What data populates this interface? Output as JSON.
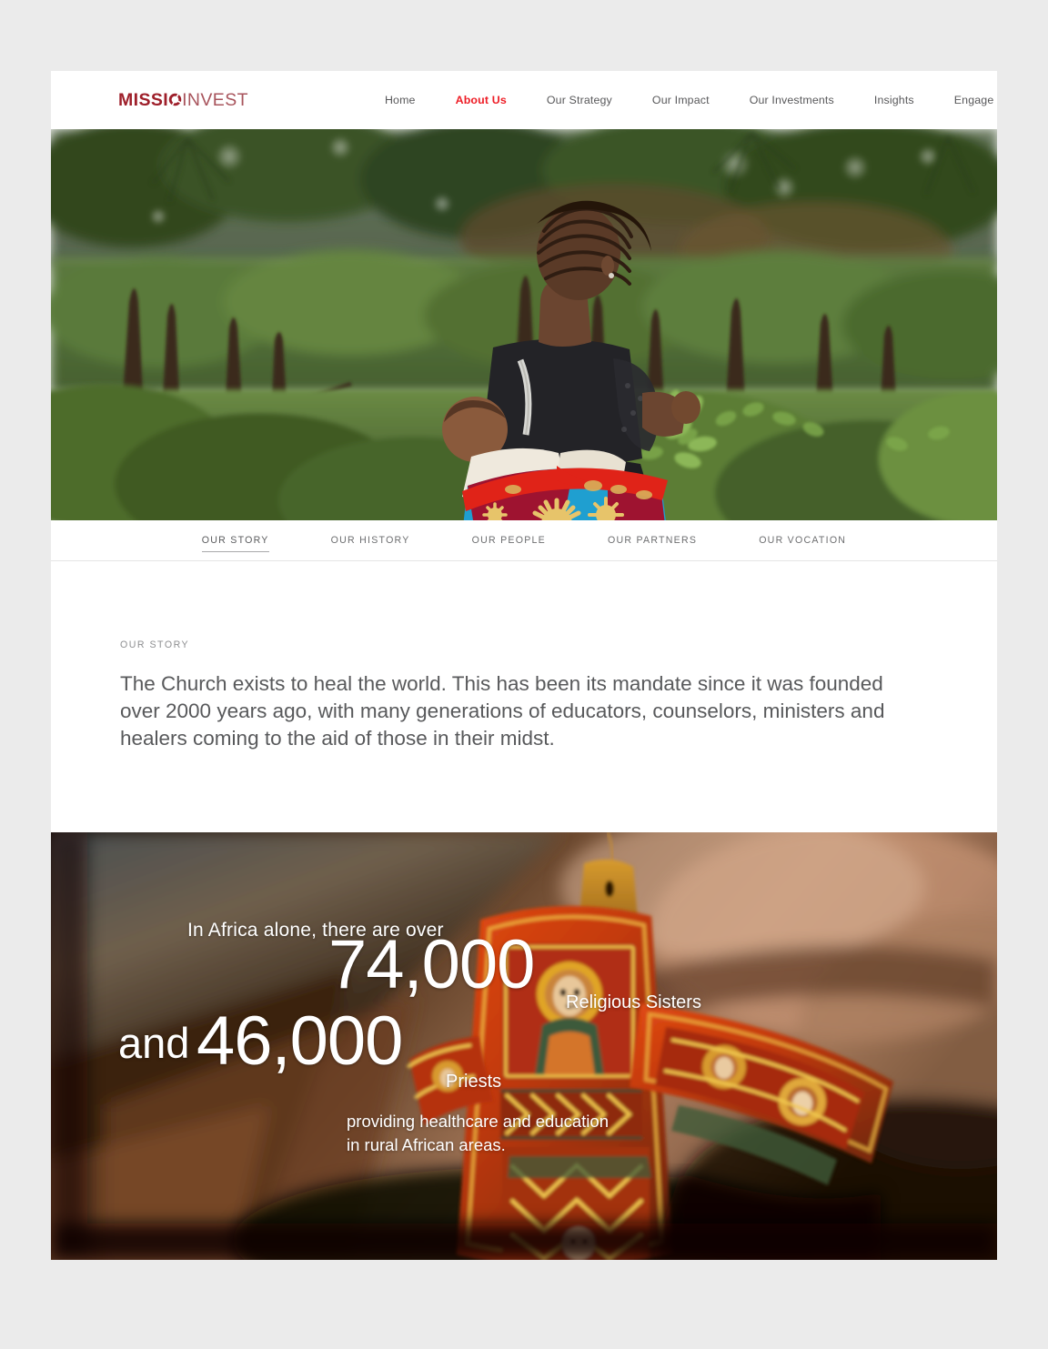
{
  "brand": {
    "logo_text_bold": "MISSI",
    "logo_icon": "missio-o-mark",
    "logo_text_light": "INVEST",
    "color_dark_red": "#9e1f2a",
    "color_light_red": "#a8545c",
    "color_active_red": "#ee1c25"
  },
  "mainnav": {
    "items": [
      {
        "label": "Home",
        "active": false
      },
      {
        "label": "About Us",
        "active": true
      },
      {
        "label": "Our Strategy",
        "active": false
      },
      {
        "label": "Our Impact",
        "active": false
      },
      {
        "label": "Our Investments",
        "active": false
      },
      {
        "label": "Insights",
        "active": false
      },
      {
        "label": "Engage | Contact",
        "active": false
      }
    ]
  },
  "hero": {
    "alt": "Woman carrying a baby in a colorful wrap, facing a lush green African forest clearing"
  },
  "subnav": {
    "items": [
      {
        "label": "OUR STORY",
        "active": true
      },
      {
        "label": "OUR HISTORY",
        "active": false
      },
      {
        "label": "OUR PEOPLE",
        "active": false
      },
      {
        "label": "OUR PARTNERS",
        "active": false
      },
      {
        "label": "OUR VOCATION",
        "active": false
      }
    ]
  },
  "story": {
    "eyebrow": "OUR STORY",
    "body": "The Church exists to heal the world. This has been its mandate since it was founded over 2000 years ago, with many generations of educators, counselors, ministers and healers coming to the aid of those in their midst."
  },
  "stats": {
    "alt": "Painted wooden Ethiopian Orthodox hand cross resting on weathered wood",
    "intro": "In Africa alone, there are over",
    "number_1": "74,000",
    "label_1": "Religious Sisters",
    "conjunction": "and",
    "number_2": "46,000",
    "label_2": "Priests",
    "tail": "providing healthcare and education\nin rural African areas."
  }
}
